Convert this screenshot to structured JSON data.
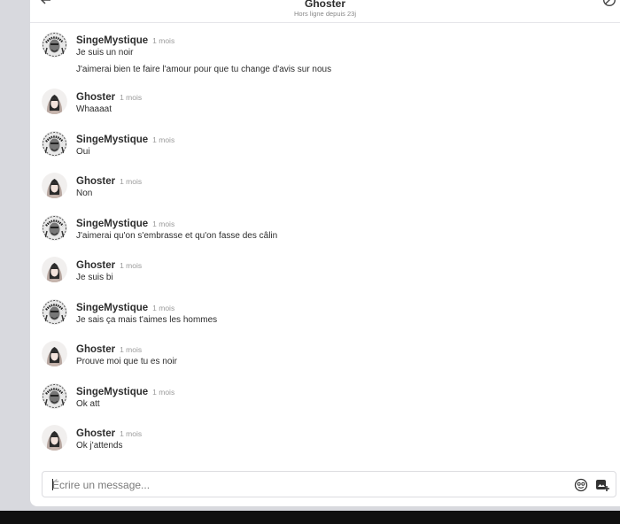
{
  "header": {
    "title": "Ghoster",
    "subtitle": "Hors ligne depuis 23j"
  },
  "icons": {
    "back": "arrow-left-icon",
    "block": "block-icon",
    "emoji": "emoji-icon",
    "sticker": "sticker-add-icon"
  },
  "messages": [
    {
      "author": "SingeMystique",
      "time": "1 mois",
      "lines": [
        "Je suis un noir",
        "J'aimerai bien te faire l'amour pour que tu change d'avis sur nous"
      ]
    },
    {
      "author": "Ghoster",
      "time": "1 mois",
      "lines": [
        "Whaaaat"
      ]
    },
    {
      "author": "SingeMystique",
      "time": "1 mois",
      "lines": [
        "Oui"
      ]
    },
    {
      "author": "Ghoster",
      "time": "1 mois",
      "lines": [
        "Non"
      ]
    },
    {
      "author": "SingeMystique",
      "time": "1 mois",
      "lines": [
        "J'aimerai qu'on s'embrasse et qu'on fasse des câlin"
      ]
    },
    {
      "author": "Ghoster",
      "time": "1 mois",
      "lines": [
        "Je suis bi"
      ]
    },
    {
      "author": "SingeMystique",
      "time": "1 mois",
      "lines": [
        "Je sais ça mais t'aimes les hommes"
      ]
    },
    {
      "author": "Ghoster",
      "time": "1 mois",
      "lines": [
        "Prouve moi que tu es noir"
      ]
    },
    {
      "author": "SingeMystique",
      "time": "1 mois",
      "lines": [
        "Ok att"
      ]
    },
    {
      "author": "Ghoster",
      "time": "1 mois",
      "lines": [
        "Ok j'attends"
      ]
    }
  ],
  "composer": {
    "placeholder": "Écrire un message...",
    "value": ""
  },
  "colors": {
    "panel": "#ffffff",
    "background": "#d8d9de",
    "taskbar": "#101010"
  }
}
